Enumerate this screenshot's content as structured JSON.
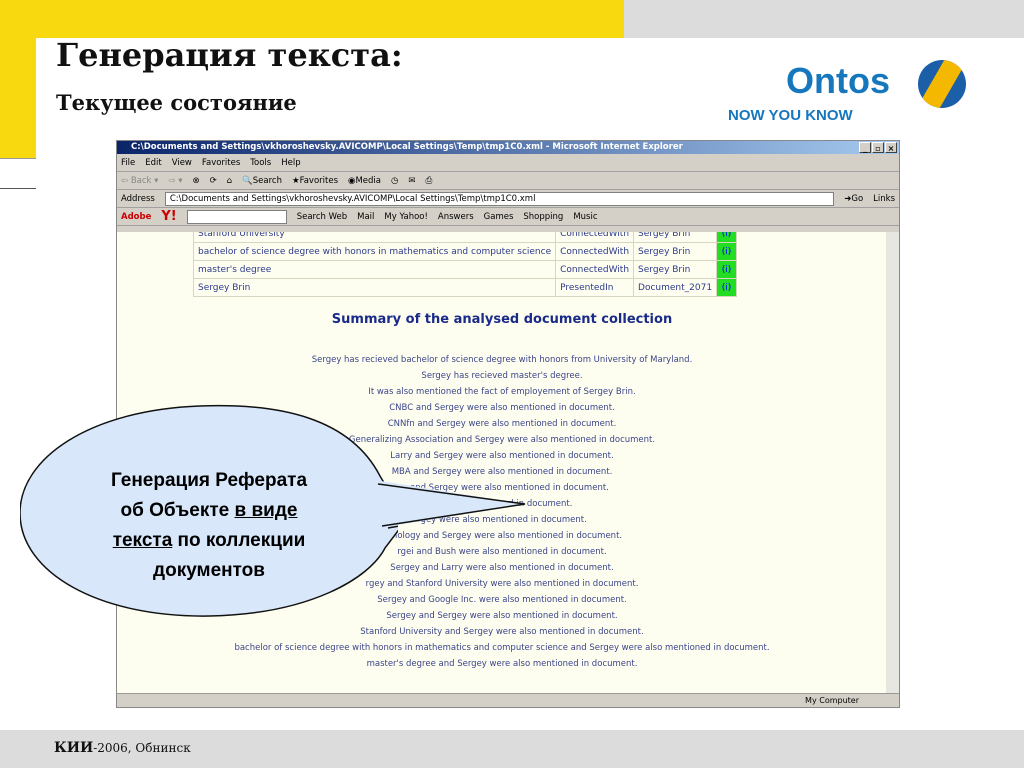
{
  "slide": {
    "title": "Генерация текста",
    "title_colon": ":",
    "subtitle": "Текущее состояние",
    "logo": "Ontos",
    "tagline": "NOW YOU KNOW",
    "footer_bold": "КИИ",
    "footer_rest": "-2006, Обнинск"
  },
  "browser": {
    "title": "C:\\Documents and Settings\\vkhoroshevsky.AVICOMP\\Local Settings\\Temp\\tmp1C0.xml - Microsoft Internet Explorer",
    "menu": [
      "File",
      "Edit",
      "View",
      "Favorites",
      "Tools",
      "Help"
    ],
    "toolbar": [
      "Back",
      "Search",
      "Favorites",
      "Media"
    ],
    "address_label": "Address",
    "address": "C:\\Documents and Settings\\vkhoroshevsky.AVICOMP\\Local Settings\\Temp\\tmp1C0.xml",
    "go": "Go",
    "links": "Links",
    "yahoo_bar": [
      "Adobe",
      "Y!",
      "Search Web",
      "Mail",
      "My Yahoo!",
      "Answers",
      "Games",
      "Shopping",
      "Music"
    ],
    "status": "My Computer"
  },
  "table": [
    [
      "Stanford University",
      "ConnectedWith",
      "Sergey Brin",
      "(i)"
    ],
    [
      "bachelor of science degree with honors in mathematics and computer science",
      "ConnectedWith",
      "Sergey Brin",
      "(i)"
    ],
    [
      "master's degree",
      "ConnectedWith",
      "Sergey Brin",
      "(i)"
    ],
    [
      "Sergey Brin",
      "PresentedIn",
      "Document_2071",
      "(i)"
    ]
  ],
  "summary_title": "Summary of the analysed document collection",
  "summary": [
    "Sergey has recieved bachelor of science degree with honors from University of Maryland.",
    "Sergey has recieved master's degree.",
    "It was also mentioned the fact of employement of Sergey Brin.",
    "CNBC and Sergey were also mentioned in document.",
    "CNNfn and Sergey were also mentioned in document.",
    "Generalizing Association and Sergey were also mentioned in document.",
    "Larry and Sergey were also mentioned in document.",
    "MBA and Sergey were also mentioned in document.",
    "ow and Sergey were also mentioned in document.",
    "ere also mentioned in document.",
    "rgey were also mentioned in document.",
    "chnology and Sergey were also mentioned in document.",
    "rgei and Bush were also mentioned in document.",
    "Sergey and Larry were also mentioned in document.",
    "rgey and Stanford University were also mentioned in document.",
    "Sergey and Google Inc. were also mentioned in document.",
    "Sergey and Sergey were also mentioned in document.",
    "Stanford University and Sergey were also mentioned in document.",
    "bachelor of science degree with honors in mathematics and computer science and Sergey were also mentioned in document.",
    "master's degree and Sergey were also mentioned in document."
  ],
  "callout": {
    "l1": "Генерация Реферата",
    "l2a": "об Объекте ",
    "l2b": "в виде",
    "l3a": "текста",
    "l3b": " по коллекции",
    "l4": "документов"
  }
}
